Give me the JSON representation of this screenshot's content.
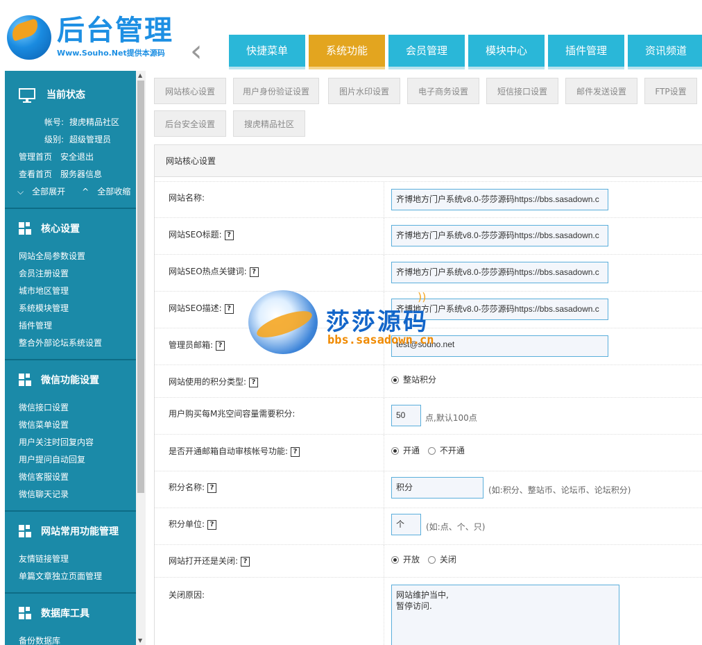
{
  "header": {
    "logo_title": "后台管理",
    "logo_subtitle": "Www.Souho.Net提供本源码",
    "back_icon": "chevron-left-icon",
    "nav": [
      {
        "label": "快捷菜单",
        "active": false
      },
      {
        "label": "系统功能",
        "active": true
      },
      {
        "label": "会员管理",
        "active": false
      },
      {
        "label": "模块中心",
        "active": false
      },
      {
        "label": "插件管理",
        "active": false
      },
      {
        "label": "资讯频道",
        "active": false
      }
    ],
    "colors": {
      "nav": "#2ab7d8",
      "nav_active": "#e3a51f",
      "sidebar": "#1b8aa8"
    }
  },
  "sidebar": {
    "status": {
      "title": "当前状态",
      "icon": "monitor-icon",
      "account_label": "帐号:",
      "account_value": "搜虎精品社区",
      "level_label": "级别:",
      "level_value": "超级管理员",
      "links_row1": [
        "管理首页",
        "安全退出"
      ],
      "links_row2": [
        "查看首页",
        "服务器信息"
      ],
      "expand_all": "全部展开",
      "collapse_all": "全部收缩"
    },
    "sections": [
      {
        "title": "核心设置",
        "items": [
          "网站全局参数设置",
          "会员注册设置",
          "城市地区管理",
          "系统模块管理",
          "插件管理",
          "整合外部论坛系统设置"
        ]
      },
      {
        "title": "微信功能设置",
        "items": [
          "微信接口设置",
          "微信菜单设置",
          "用户关注时回复内容",
          "用户提问自动回复",
          "微信客服设置",
          "微信聊天记录"
        ]
      },
      {
        "title": "网站常用功能管理",
        "items": [
          "友情链接管理",
          "单篇文章独立页面管理"
        ]
      },
      {
        "title": "数据库工具",
        "items": [
          "备份数据库"
        ]
      }
    ]
  },
  "subtabs": [
    "网站核心设置",
    "用户身份验证设置",
    "图片水印设置",
    "电子商务设置",
    "短信接口设置",
    "邮件发送设置",
    "FTP设置",
    "后台安全设置",
    "搜虎精品社区"
  ],
  "panel": {
    "title": "网站核心设置",
    "help_glyph": "?",
    "fields": {
      "site_name": {
        "label": "网站名称:",
        "value": "齐博地方门户系统v8.0-莎莎源码https://bbs.sasadown.c"
      },
      "seo_title": {
        "label": "网站SEO标题:",
        "value": "齐博地方门户系统v8.0-莎莎源码https://bbs.sasadown.c"
      },
      "seo_keywords": {
        "label": "网站SEO热点关键词:",
        "value": "齐博地方门户系统v8.0-莎莎源码https://bbs.sasadown.c"
      },
      "seo_desc": {
        "label": "网站SEO描述:",
        "value": "齐博地方门户系统v8.0-莎莎源码https://bbs.sasadown.c"
      },
      "admin_email": {
        "label": "管理员邮箱:",
        "value": "test@souho.net"
      },
      "points_type": {
        "label": "网站使用的积分类型:",
        "option": "整站积分"
      },
      "space_cost": {
        "label": "用户购买每M兆空间容量需要积分:",
        "value": "50",
        "hint": "点,默认100点"
      },
      "email_verify": {
        "label": "是否开通邮箱自动审核帐号功能:",
        "options": [
          "开通",
          "不开通"
        ],
        "selected": 0
      },
      "points_name": {
        "label": "积分名称:",
        "value": "积分",
        "hint": "(如:积分、整站币、论坛币、论坛积分)"
      },
      "points_unit": {
        "label": "积分单位:",
        "value": "个",
        "hint": "(如:点、个、只)"
      },
      "site_open": {
        "label": "网站打开还是关闭:",
        "options": [
          "开放",
          "关闭"
        ],
        "selected": 0
      },
      "close_reason": {
        "label": "关闭原因:",
        "value_line1": "网站维护当中,",
        "value_line2": "暂停访问."
      }
    }
  },
  "watermark": {
    "cn": "莎莎源码",
    "en": "bbs.sasadown.cn"
  }
}
